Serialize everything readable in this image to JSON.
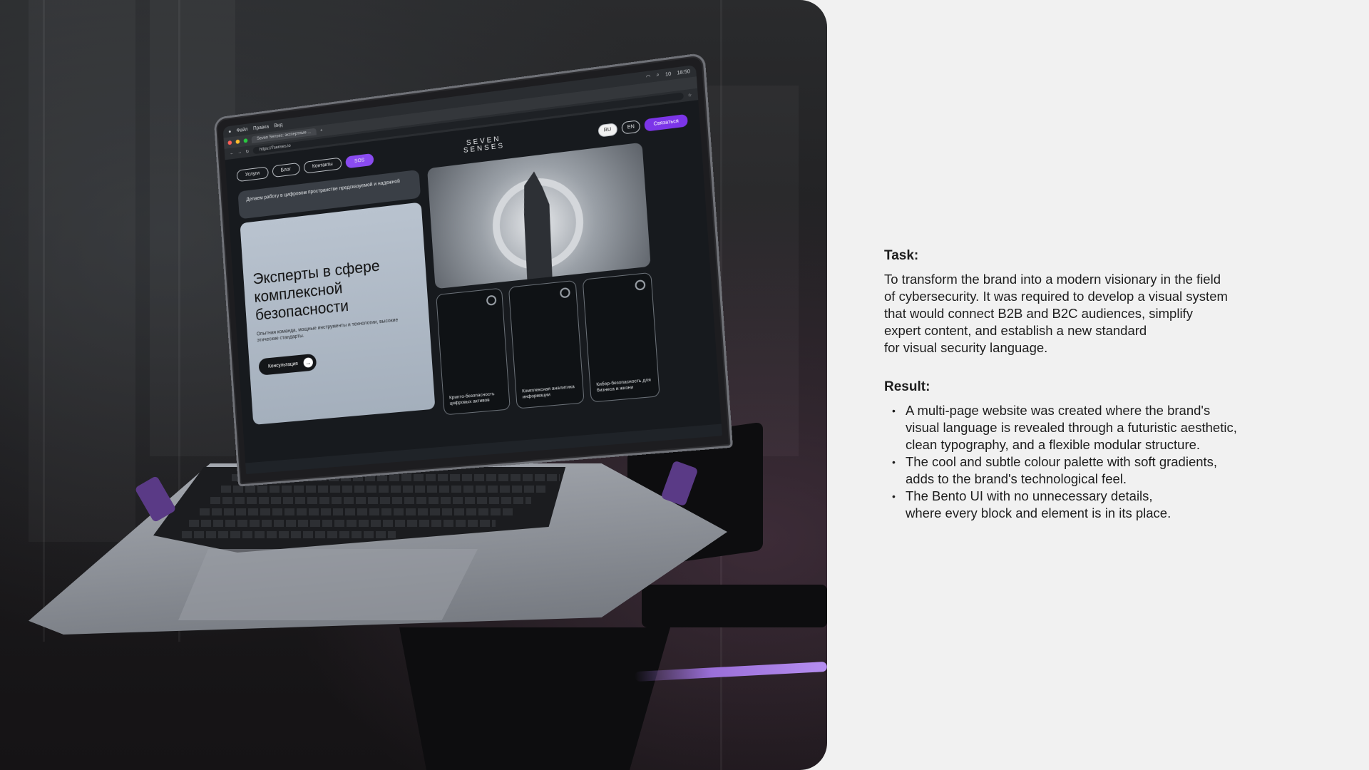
{
  "left_image": {
    "mac_menu": [
      "Файл",
      "Правка",
      "Вид"
    ],
    "status_time": "18:50",
    "status_battery": "10",
    "browser_tab": "Seven Senses: экспертные ...",
    "url": "https://7senses.io",
    "site": {
      "nav": [
        "Услуги",
        "Блог",
        "Контакты",
        "SOS"
      ],
      "logo_line1": "SEVEN",
      "logo_line2": "SENSES",
      "lang_ru": "RU",
      "lang_en": "EN",
      "cta": "Связаться",
      "tagline": "Делаем работу в цифровом пространстве предсказуемой и надежной",
      "hero_title": "Эксперты в сфере комплексной безопасности",
      "hero_subtitle": "Опытная команда, мощные инструменты и технологии, высокие этические стандарты.",
      "hero_button": "Консультация",
      "cards": [
        "Крипто-безопасность цифровых активов",
        "Комплексная аналитика информации",
        "Кибер-безопасность для бизнеса и жизни"
      ]
    }
  },
  "task": {
    "heading": "Task:",
    "text": "To transform the brand into a modern visionary in the field\nof cybersecurity. It was required to develop a visual system\nthat would connect B2B and B2C audiences, simplify\nexpert content, and establish a new standard\nfor visual security language."
  },
  "result": {
    "heading": "Result:",
    "items": [
      "A multi-page website was created where the brand's\nvisual language is revealed through a futuristic aesthetic,\nclean typography, and a flexible modular structure.",
      "The cool and subtle colour palette with soft gradients,\nadds to the brand's technological feel.",
      "The Bento UI with no unnecessary details,\nwhere every block and element is in its place."
    ]
  },
  "colors": {
    "background": "#f1f1f1",
    "text": "#1e1e1e",
    "accent_purple": "#7c35e8"
  }
}
